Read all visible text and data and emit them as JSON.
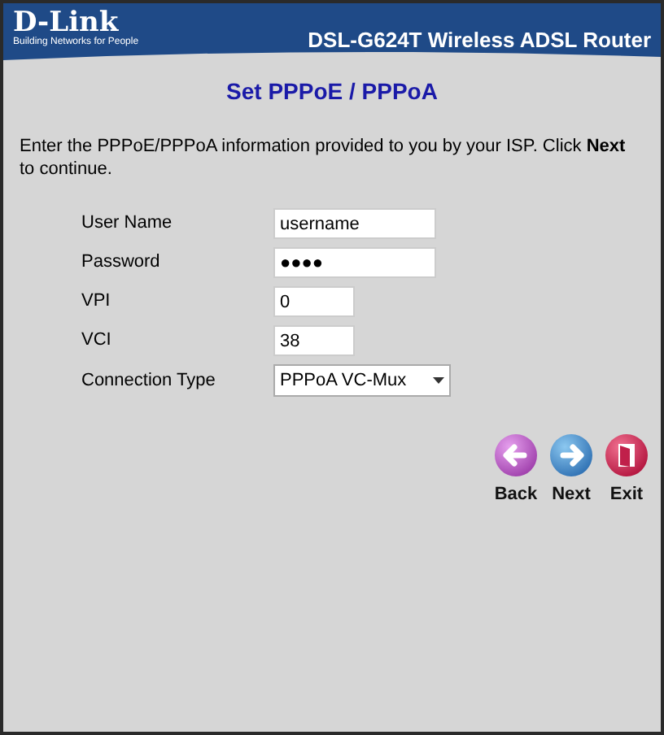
{
  "header": {
    "logo": "D-Link",
    "tagline": "Building Networks for People",
    "product": "DSL-G624T Wireless ADSL Router"
  },
  "title": "Set PPPoE / PPPoA",
  "intro": "Enter the PPPoE/PPPoA information provided to you by your ISP. Click **Next** to continue.",
  "fields": [
    {
      "label": "User Name",
      "value": "username",
      "kind": "text"
    },
    {
      "label": "Password",
      "value": "●●●●",
      "kind": "text"
    },
    {
      "label": "VPI",
      "value": "0",
      "kind": "short"
    },
    {
      "label": "VCI",
      "value": "38",
      "kind": "short"
    },
    {
      "label": "Connection Type",
      "value": "PPPoA VC-Mux",
      "kind": "select"
    }
  ],
  "nav": [
    {
      "label": "Back",
      "kind": "back"
    },
    {
      "label": "Next",
      "kind": "next"
    },
    {
      "label": "Exit",
      "kind": "exit"
    }
  ]
}
